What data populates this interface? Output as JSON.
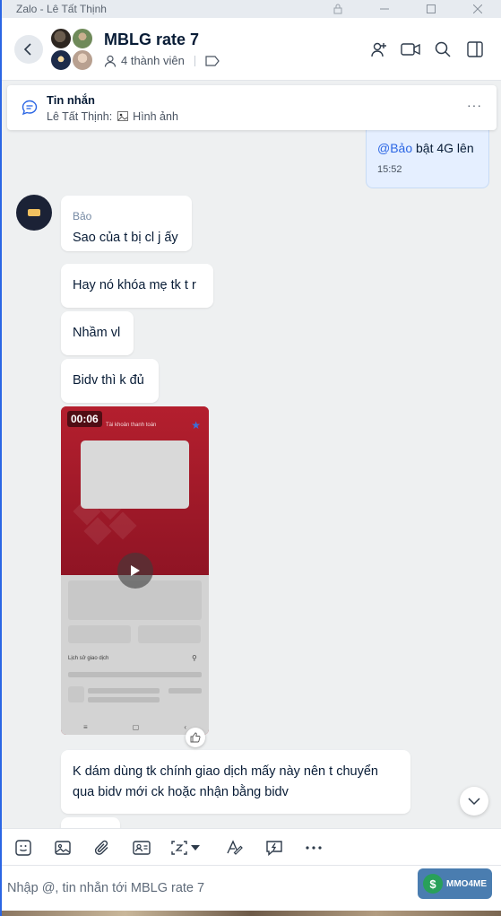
{
  "window": {
    "title": "Zalo - Lê Tất Thịnh"
  },
  "header": {
    "group_name": "MBLG rate 7",
    "members": "4 thành viên"
  },
  "pinned": {
    "title": "Tin nhắn",
    "subtitle_sender": "Lê Tất Thịnh:",
    "subtitle_content": "Hình ảnh"
  },
  "my_message": {
    "mention": "@Bảo",
    "text": " bật 4G lên",
    "time": "15:52"
  },
  "messages": {
    "sender": "Bảo",
    "items": [
      {
        "text": "Sao của t bị cl j ấy"
      },
      {
        "text": "Hay nó khóa mẹ tk t r"
      },
      {
        "text": "Nhầm vl"
      },
      {
        "text": "Bidv thì k đủ"
      },
      {
        "text": "K dám dùng tk chính giao dịch mấy này nên t chuyển"
      },
      {
        "text": "qua bidv mới ck hoặc nhận bằng bidv"
      }
    ]
  },
  "video": {
    "duration": "00:06",
    "screen_header": "Tài khoản thanh toán",
    "screen_history": "Lịch sử giao dịch"
  },
  "input": {
    "placeholder": "Nhập @, tin nhắn tới MBLG rate 7"
  },
  "watermark": {
    "text": "MMO4ME"
  },
  "colors": {
    "accent": "#2b66e4",
    "bubble_mine": "#e5efff",
    "chat_bg": "#eef0f1"
  }
}
